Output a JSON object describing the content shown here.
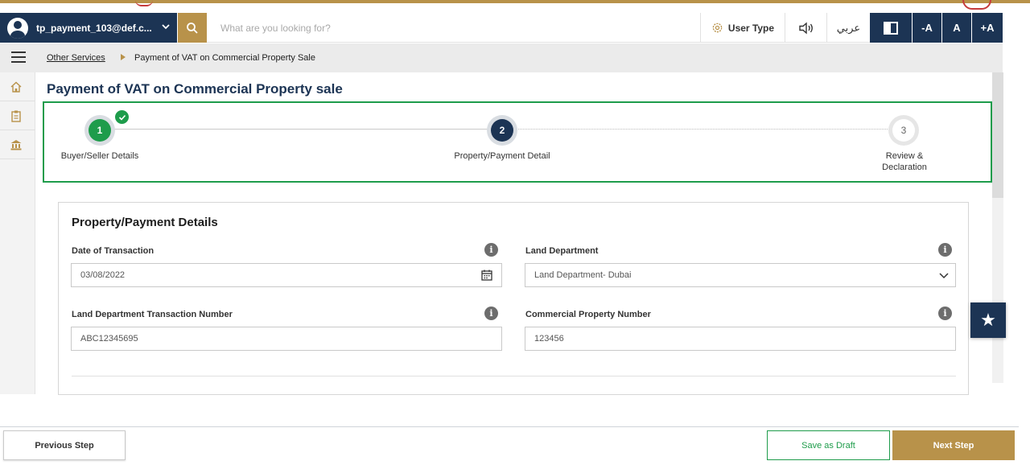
{
  "header": {
    "user_name": "tp_payment_103@def.c...",
    "search_placeholder": "What are you looking for?",
    "user_type_label": "User Type",
    "language_label": "عربي",
    "font_decrease": "-A",
    "font_normal": "A",
    "font_increase": "+A"
  },
  "breadcrumb": {
    "parent": "Other Services",
    "current": "Payment of VAT on Commercial Property Sale"
  },
  "page_title": "Payment of VAT on Commercial Property sale",
  "stepper": {
    "steps": [
      {
        "number": "1",
        "label": "Buyer/Seller Details",
        "status": "completed"
      },
      {
        "number": "2",
        "label": "Property/Payment Detail",
        "status": "active"
      },
      {
        "number": "3",
        "label": "Review & Declaration",
        "status": "pending"
      }
    ]
  },
  "form": {
    "title": "Property/Payment Details",
    "date_of_transaction": {
      "label": "Date of Transaction",
      "value": "03/08/2022"
    },
    "land_department": {
      "label": "Land Department",
      "value": "Land Department- Dubai"
    },
    "ld_transaction_number": {
      "label": "Land Department Transaction Number",
      "value": "ABC12345695"
    },
    "commercial_property_number": {
      "label": "Commercial Property Number",
      "value": "123456"
    }
  },
  "actions": {
    "previous": "Previous Step",
    "save_draft": "Save as Draft",
    "next": "Next Step"
  },
  "icons": {
    "search": "search-icon",
    "settings": "gear-icon",
    "speaker": "speaker-icon",
    "contrast": "contrast-icon",
    "menu": "hamburger-icon",
    "home": "home-icon",
    "clipboard": "clipboard-icon",
    "bank": "bank-icon",
    "calendar": "calendar-icon",
    "info": "info-icon",
    "favorite": "star-icon"
  },
  "colors": {
    "navy": "#1c3454",
    "gold": "#b8924a",
    "green": "#1e9c4b"
  }
}
